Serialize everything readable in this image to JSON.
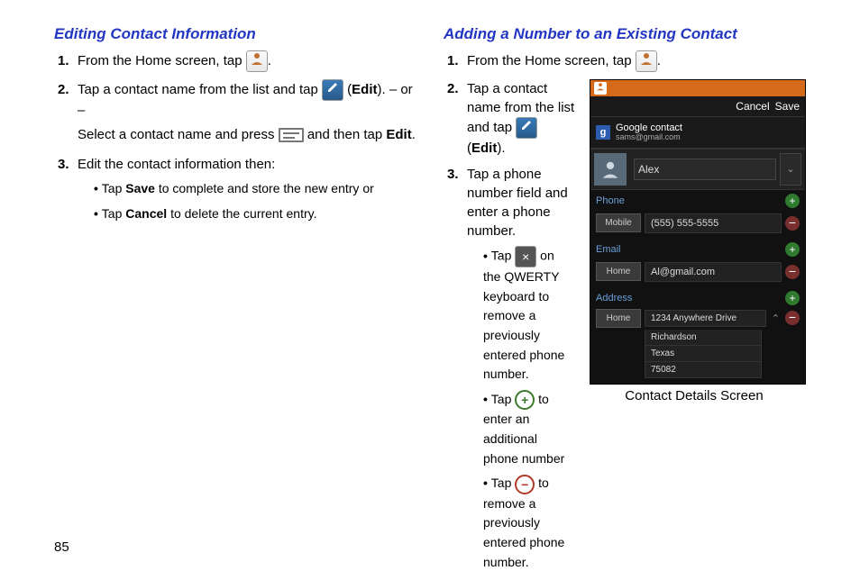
{
  "page_number": "85",
  "left": {
    "heading": "Editing Contact Information",
    "step1_a": "From the Home screen, tap ",
    "step1_b": ".",
    "step2_a": "Tap a contact name from the list and tap ",
    "step2_b": " (",
    "step2_edit": "Edit",
    "step2_c": "). – or –",
    "step2_d": "Select a contact name and press ",
    "step2_e": " and then tap ",
    "step2_edit2": "Edit",
    "step2_f": ".",
    "step3": "Edit the contact information then:",
    "b1_a": "Tap ",
    "b1_save": "Save",
    "b1_b": " to complete and store the new entry or",
    "b2_a": "Tap ",
    "b2_cancel": "Cancel",
    "b2_b": " to delete the current entry."
  },
  "right": {
    "heading": "Adding a Number to an Existing Contact",
    "step1_a": "From the Home screen, tap ",
    "step1_b": ".",
    "step2_a": "Tap a contact name from the list and tap ",
    "step2_b": " (",
    "step2_edit": "Edit",
    "step2_c": ").",
    "step3": "Tap a phone number field and enter a phone number.",
    "b1_a": "Tap ",
    "b1_b": " on the QWERTY keyboard to remove a previously entered phone number.",
    "b2_a": "Tap ",
    "b2_b": " to enter an additional phone number",
    "b3_a": "Tap ",
    "b3_b": " to remove a previously entered phone number.",
    "caption": "Contact Details Screen"
  },
  "screen": {
    "cancel": "Cancel",
    "save": "Save",
    "google_contact": "Google contact",
    "google_email": "sams@gmail.com",
    "name": "Alex",
    "phone_label": "Phone",
    "phone_type": "Mobile",
    "phone_value": "(555) 555-5555",
    "email_label": "Email",
    "email_type": "Home",
    "email_value": "Al@gmail.com",
    "address_label": "Address",
    "address_type": "Home",
    "addr1": "1234 Anywhere Drive",
    "addr2": "Richardson",
    "addr3": "Texas",
    "addr4": "75082"
  }
}
